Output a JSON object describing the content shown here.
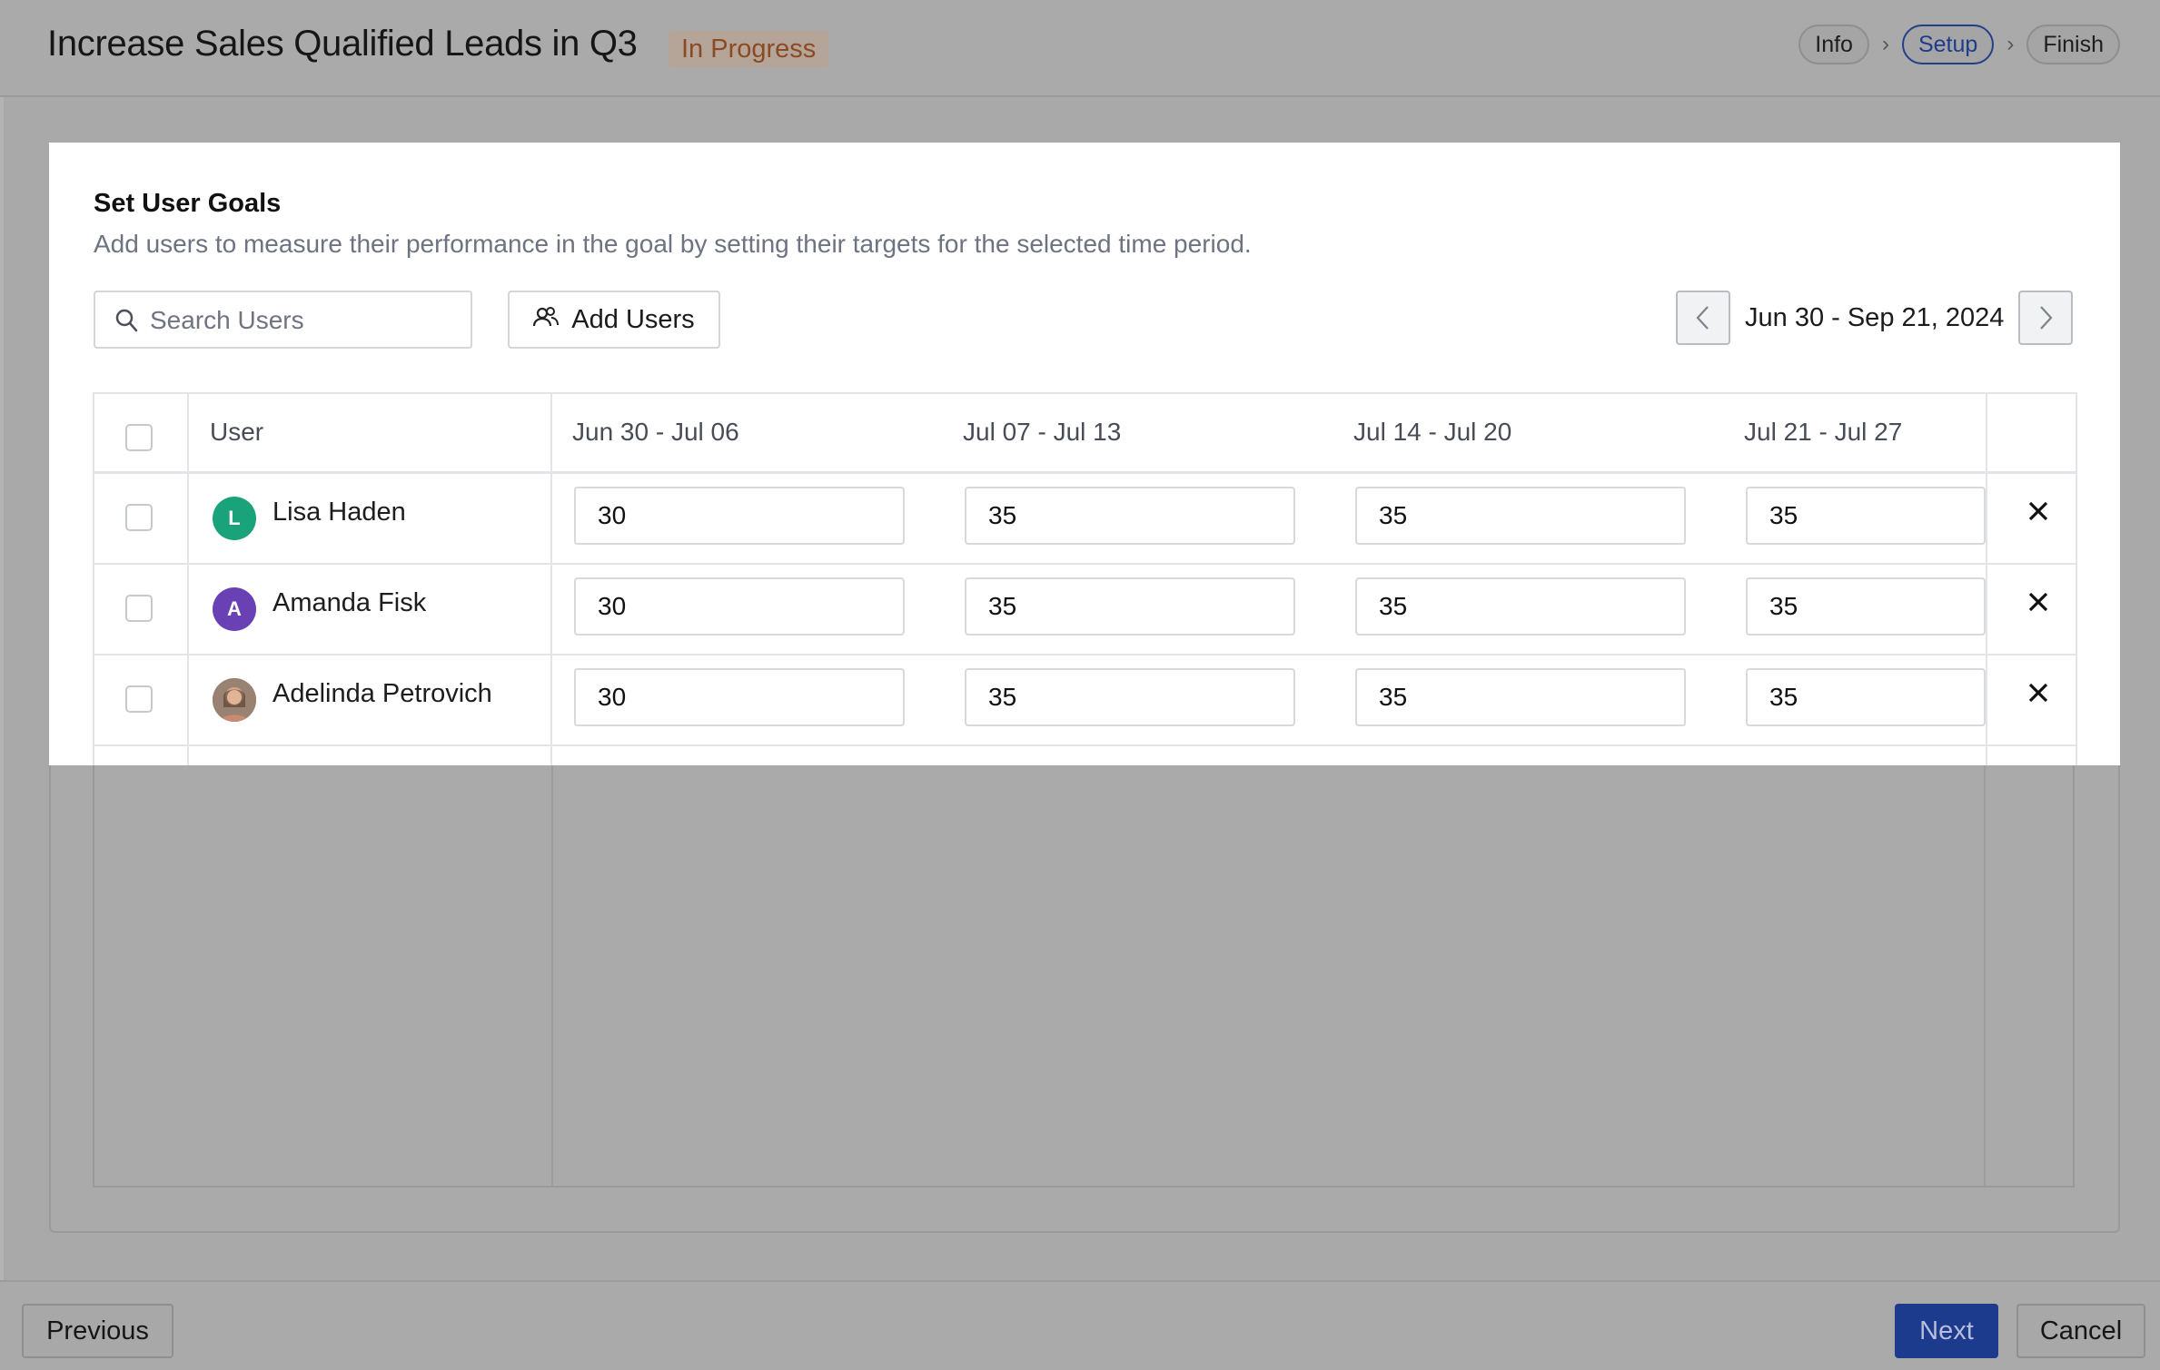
{
  "header": {
    "title": "Increase Sales Qualified Leads in Q3",
    "status": "In Progress",
    "steps": [
      "Info",
      "Setup",
      "Finish"
    ],
    "active_step": "Setup"
  },
  "panel": {
    "title": "Set User Goals",
    "description": "Add users to measure their performance in the goal by setting their targets for the selected time period.",
    "search_placeholder": "Search Users",
    "add_users_label": "Add Users",
    "date_range": "Jun 30 - Sep 21, 2024"
  },
  "table": {
    "headers": {
      "user": "User",
      "weeks": [
        "Jun 30 - Jul 06",
        "Jul 07 - Jul 13",
        "Jul 14 - Jul 20",
        "Jul 21 - Jul 27"
      ]
    },
    "rows": [
      {
        "initial": "L",
        "name": "Lisa Haden",
        "avatar_color": "#1aa37a",
        "values": [
          "30",
          "35",
          "35",
          "35"
        ]
      },
      {
        "initial": "A",
        "name": "Amanda Fisk",
        "avatar_color": "#6a41b5",
        "values": [
          "30",
          "35",
          "35",
          "35"
        ]
      },
      {
        "initial": "",
        "name": "Adelinda Petrovich",
        "avatar_color": "#8a6b58",
        "values": [
          "30",
          "35",
          "35",
          "35"
        ]
      }
    ]
  },
  "footer": {
    "previous_label": "Previous",
    "next_label": "Next",
    "cancel_label": "Cancel"
  },
  "icons": {
    "search": "search-icon",
    "add_users": "users-icon",
    "prev_period": "chevron-left-icon",
    "next_period": "chevron-right-icon",
    "remove": "close-icon"
  },
  "colors": {
    "accent": "#1c3b8c",
    "status_text": "#8a4a25"
  }
}
